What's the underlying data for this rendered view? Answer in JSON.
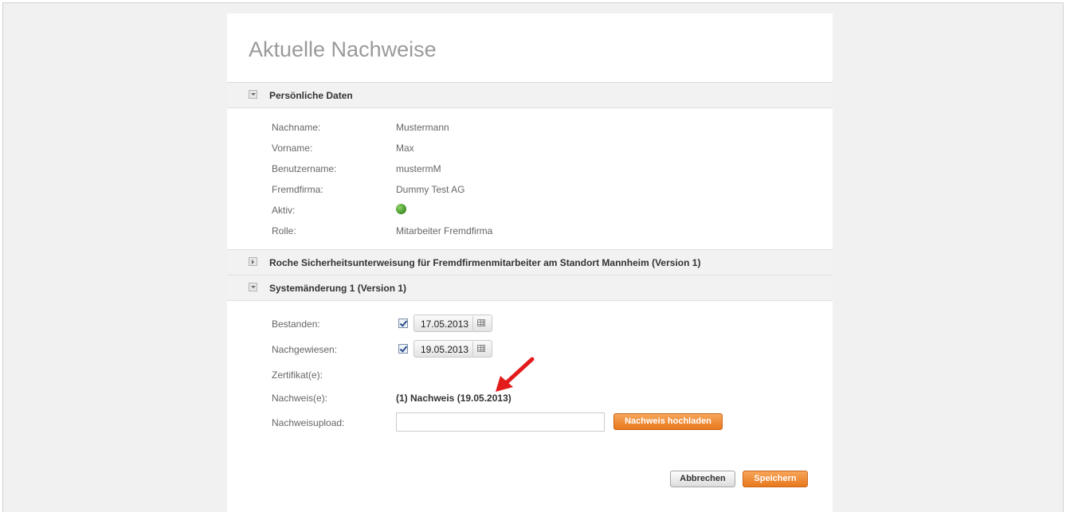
{
  "page": {
    "title": "Aktuelle Nachweise"
  },
  "sections": {
    "personal": {
      "title": "Persönliche Daten",
      "expanded": true
    },
    "roche": {
      "title": "Roche Sicherheitsunterweisung für Fremdfirmenmitarbeiter am Standort Mannheim (Version 1)",
      "expanded": false
    },
    "system": {
      "title": "Systemänderung 1 (Version 1)",
      "expanded": true
    }
  },
  "personal": {
    "rows": [
      {
        "label": "Nachname:",
        "value": "Mustermann"
      },
      {
        "label": "Vorname:",
        "value": "Max"
      },
      {
        "label": "Benutzername:",
        "value": "mustermM"
      },
      {
        "label": "Fremdfirma:",
        "value": "Dummy Test AG"
      },
      {
        "label": "Aktiv:",
        "value_icon": "green-status-dot",
        "status_color": "#4a9a2e"
      },
      {
        "label": "Rolle:",
        "value": "Mitarbeiter Fremdfirma"
      }
    ]
  },
  "system": {
    "bestanden": {
      "label": "Bestanden:",
      "checked": true,
      "date": "17.05.2013"
    },
    "nachgewiesen": {
      "label": "Nachgewiesen:",
      "checked": true,
      "date": "19.05.2013"
    },
    "zertifikat": {
      "label": "Zertifikat(e):"
    },
    "nachweis": {
      "label": "Nachweis(e):",
      "value": "(1) Nachweis (19.05.2013)"
    },
    "upload": {
      "label": "Nachweisupload:",
      "value": "",
      "button": "Nachweis hochladen"
    }
  },
  "actions": {
    "cancel": "Abbrechen",
    "save": "Speichern"
  },
  "colors": {
    "accent": "#e8781c",
    "annotation_arrow": "#e31b1b"
  }
}
